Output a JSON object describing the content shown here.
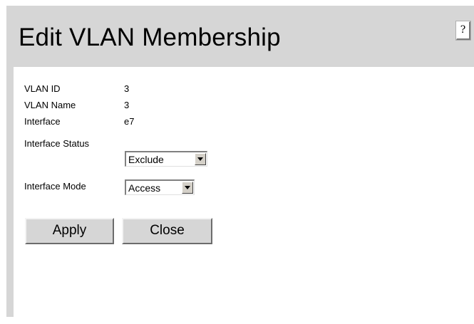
{
  "page": {
    "title": "Edit VLAN Membership",
    "help_label": "?"
  },
  "fields": {
    "vlan_id": {
      "label": "VLAN ID",
      "value": "3"
    },
    "vlan_name": {
      "label": "VLAN Name",
      "value": "3"
    },
    "interface": {
      "label": "Interface",
      "value": "e7"
    },
    "interface_status": {
      "label": "Interface Status",
      "selected": "Exclude"
    },
    "interface_mode": {
      "label": "Interface Mode",
      "selected": "Access"
    }
  },
  "buttons": {
    "apply": "Apply",
    "close": "Close"
  },
  "colors": {
    "panel_gray": "#d6d6d6",
    "content_white": "#ffffff"
  },
  "icons": {
    "dropdown": "chevron-down-icon"
  }
}
